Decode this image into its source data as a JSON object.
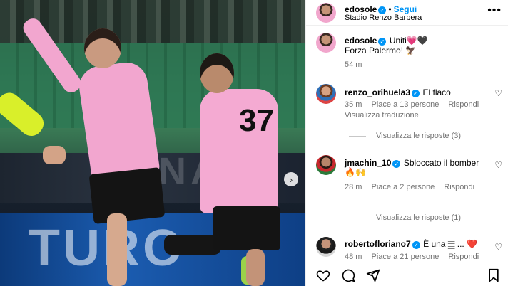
{
  "post": {
    "author": "edosole",
    "follow_label": "Segui",
    "location": "Stadio Renzo Barbera",
    "photo_banner_text": "SNAI",
    "photo_board_text": "TURO",
    "player_number": "37"
  },
  "caption": {
    "author": "edosole",
    "line1": "Uniti💗🖤",
    "line2": "Forza Palermo! 🦅",
    "time": "54 m"
  },
  "comments": [
    {
      "username": "renzo_orihuela3",
      "text": "El flaco",
      "time": "35 m",
      "likes": "Piace a 13 persone",
      "reply": "Rispondi",
      "translate": "Visualizza traduzione",
      "replies": "Visualizza le risposte (3)"
    },
    {
      "username": "jmachin_10",
      "text": "Sbloccato il bomber",
      "text2": "🔥🙌",
      "time": "28 m",
      "likes": "Piace a 2 persone",
      "reply": "Rispondi",
      "replies": "Visualizza le risposte (1)"
    },
    {
      "username": "robertofloriano7",
      "text": "È una 𝄛 ... ❤️",
      "time": "48 m",
      "likes": "Piace a 21 persone",
      "reply": "Rispondi"
    }
  ],
  "icons": {
    "more": "more-icon",
    "like": "heart-icon",
    "comment": "comment-icon",
    "share": "share-icon",
    "save": "bookmark-icon",
    "next": "chevron-right-icon",
    "verified": "verified-badge-icon"
  },
  "colors": {
    "accent": "#0095f6",
    "secondary_text": "#737373",
    "kit_pink": "#f2a6cf"
  }
}
